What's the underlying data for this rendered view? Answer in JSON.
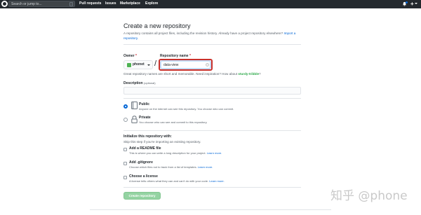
{
  "header": {
    "search_placeholder": "Search or jump to...",
    "search_shortcut": "/",
    "nav": [
      "Pull requests",
      "Issues",
      "Marketplace",
      "Explore"
    ],
    "plus_symbol": "+"
  },
  "page": {
    "title": "Create a new repository",
    "subtitle_text": "A repository contains all project files, including the revision history. Already have a project repository elsewhere?",
    "import_link": "Import a repository."
  },
  "owner": {
    "label": "Owner",
    "required_mark": "*",
    "value": "phonet"
  },
  "repo_name": {
    "label": "Repository name",
    "required_mark": "*",
    "separator": "/",
    "value": "data-view"
  },
  "hint": {
    "text": "Great repository names are short and memorable. Need inspiration? How about",
    "suggestion": "sturdy-tribble",
    "end": "?"
  },
  "description": {
    "label": "Description",
    "optional": "(optional)",
    "value": ""
  },
  "visibility": {
    "public": {
      "title": "Public",
      "desc": "Anyone on the internet can see this repository. You choose who can commit.",
      "checked": true
    },
    "private": {
      "title": "Private",
      "desc": "You choose who can see and commit to this repository.",
      "checked": false
    }
  },
  "init": {
    "title": "Initialize this repository with:",
    "subtitle": "Skip this step if you're importing an existing repository.",
    "options": [
      {
        "title": "Add a README file",
        "desc": "This is where you can write a long description for your project.",
        "link": "Learn more."
      },
      {
        "title": "Add .gitignore",
        "desc": "Choose which files not to track from a list of templates.",
        "link": "Learn more."
      },
      {
        "title": "Choose a license",
        "desc": "A license tells others what they can and can't do with your code.",
        "link": "Learn more."
      }
    ]
  },
  "create_button": "Create repository",
  "watermark": "知乎 @phone",
  "colors": {
    "header_bg": "#24292e",
    "link": "#0366d6",
    "suggestion": "#28a745",
    "highlight_box": "#c9312b",
    "button_disabled": "#94d3a2"
  }
}
